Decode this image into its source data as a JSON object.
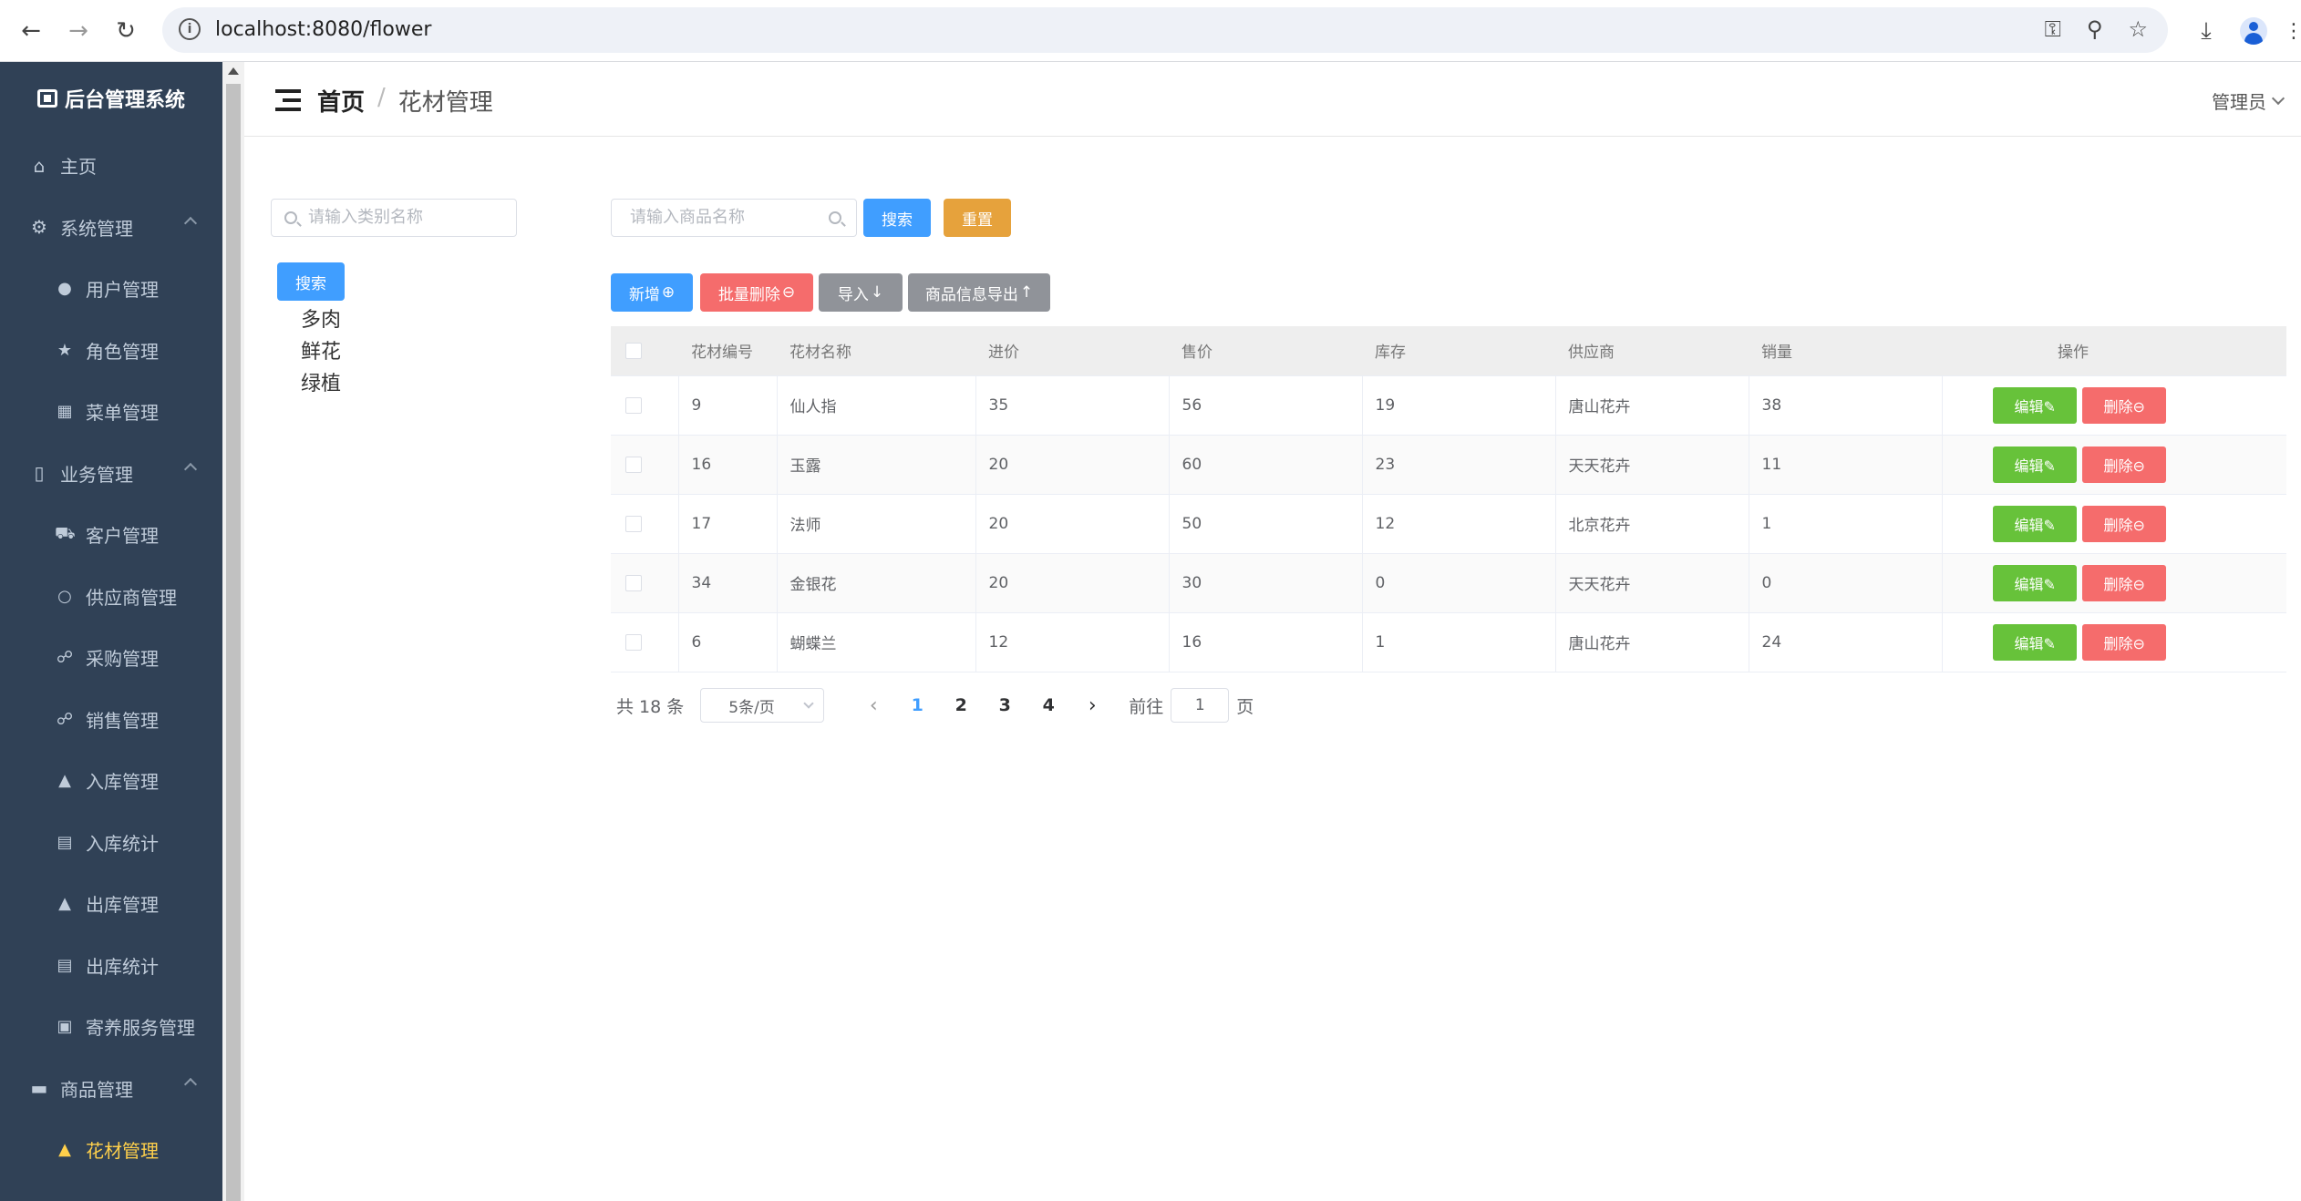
{
  "browser": {
    "url": "localhost:8080/flower"
  },
  "sidebar": {
    "title": "后台管理系统",
    "items": [
      {
        "label": "主页",
        "icon": "home-icon"
      },
      {
        "label": "系统管理",
        "icon": "gear-icon"
      },
      {
        "label": "用户管理",
        "icon": "user-icon"
      },
      {
        "label": "角色管理",
        "icon": "star-icon"
      },
      {
        "label": "菜单管理",
        "icon": "grid-icon"
      },
      {
        "label": "业务管理",
        "icon": "phone-icon"
      },
      {
        "label": "客户管理",
        "icon": "truck-icon"
      },
      {
        "label": "供应商管理",
        "icon": "person-icon"
      },
      {
        "label": "采购管理",
        "icon": "cart-icon"
      },
      {
        "label": "销售管理",
        "icon": "cart-icon"
      },
      {
        "label": "入库管理",
        "icon": "bag-icon"
      },
      {
        "label": "入库统计",
        "icon": "bar-chart-icon"
      },
      {
        "label": "出库管理",
        "icon": "bag-icon"
      },
      {
        "label": "出库统计",
        "icon": "bar-chart-icon"
      },
      {
        "label": "寄养服务管理",
        "icon": "box-icon"
      },
      {
        "label": "商品管理",
        "icon": "monitor-icon"
      },
      {
        "label": "花材管理",
        "icon": "bag-icon"
      }
    ],
    "active_color": "#ffd04b",
    "bg_color": "#304156"
  },
  "header": {
    "home": "首页",
    "separator": "/",
    "current": "花材管理",
    "user": "管理员"
  },
  "category": {
    "placeholder": "请输入类别名称",
    "search_label": "搜索",
    "items": [
      "多肉",
      "鲜花",
      "绿植"
    ]
  },
  "toolbar": {
    "product_placeholder": "请输入商品名称",
    "search_label": "搜索",
    "reset_label": "重置",
    "add_label": "新增",
    "batch_delete_label": "批量删除",
    "import_label": "导入",
    "export_label": "商品信息导出"
  },
  "table": {
    "headers": [
      "花材编号",
      "花材名称",
      "进价",
      "售价",
      "库存",
      "供应商",
      "销量",
      "操作"
    ],
    "rows": [
      [
        "9",
        "仙人指",
        "35",
        "56",
        "19",
        "唐山花卉",
        "38"
      ],
      [
        "16",
        "玉露",
        "20",
        "60",
        "23",
        "天天花卉",
        "11"
      ],
      [
        "17",
        "法师",
        "20",
        "50",
        "12",
        "北京花卉",
        "1"
      ],
      [
        "34",
        "金银花",
        "20",
        "30",
        "0",
        "天天花卉",
        "0"
      ],
      [
        "6",
        "蝴蝶兰",
        "12",
        "16",
        "1",
        "唐山花卉",
        "24"
      ]
    ],
    "edit_label": "编辑",
    "delete_label": "删除"
  },
  "pagination": {
    "total": "共 18 条",
    "page_size": "5条/页",
    "pages": [
      "1",
      "2",
      "3",
      "4"
    ],
    "current": "1",
    "goto_prefix": "前往",
    "goto_value": "1",
    "goto_suffix": "页"
  }
}
